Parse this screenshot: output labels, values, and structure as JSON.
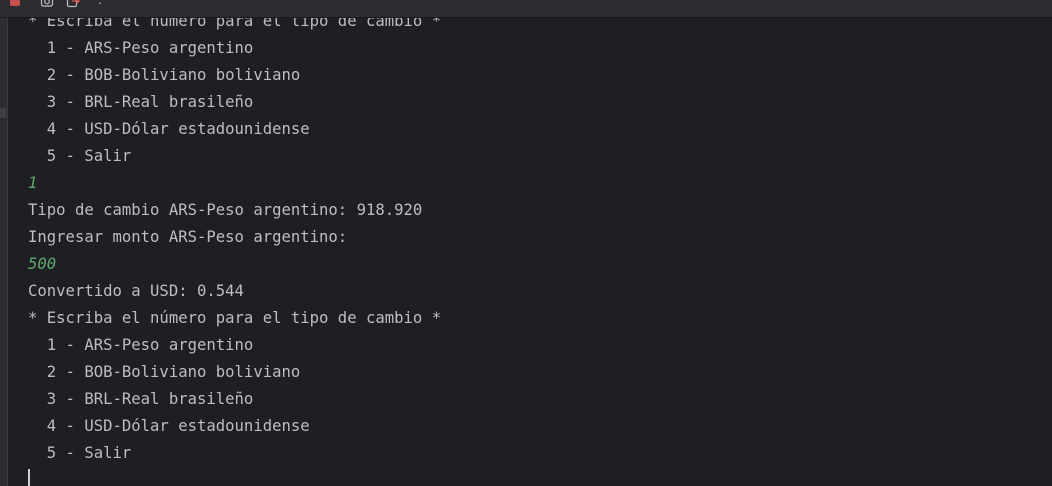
{
  "toolbar": {
    "icons": [
      "stop-icon",
      "camera-icon",
      "exit-icon",
      "more-icon"
    ],
    "more_label": "⋮"
  },
  "console": {
    "lines": [
      {
        "text": "* Escriba el número para el tipo de cambio *",
        "kind": "output"
      },
      {
        "text": "  1 - ARS-Peso argentino",
        "kind": "output"
      },
      {
        "text": "  2 - BOB-Boliviano boliviano",
        "kind": "output"
      },
      {
        "text": "  3 - BRL-Real brasileño",
        "kind": "output"
      },
      {
        "text": "  4 - USD-Dólar estadounidense",
        "kind": "output"
      },
      {
        "text": "  5 - Salir",
        "kind": "output"
      },
      {
        "text": "1",
        "kind": "input"
      },
      {
        "text": "Tipo de cambio ARS-Peso argentino: 918.920",
        "kind": "output"
      },
      {
        "text": "Ingresar monto ARS-Peso argentino:",
        "kind": "output"
      },
      {
        "text": "500",
        "kind": "input"
      },
      {
        "text": "Convertido a USD: 0.544",
        "kind": "output"
      },
      {
        "text": "* Escriba el número para el tipo de cambio *",
        "kind": "output"
      },
      {
        "text": "  1 - ARS-Peso argentino",
        "kind": "output"
      },
      {
        "text": "  2 - BOB-Boliviano boliviano",
        "kind": "output"
      },
      {
        "text": "  3 - BRL-Real brasileño",
        "kind": "output"
      },
      {
        "text": "  4 - USD-Dólar estadounidense",
        "kind": "output"
      },
      {
        "text": "  5 - Salir",
        "kind": "output"
      }
    ]
  },
  "colors": {
    "background": "#1e1f22",
    "output_text": "#bcbec4",
    "input_text": "#5fa86f",
    "stop_red": "#c94f4f"
  }
}
